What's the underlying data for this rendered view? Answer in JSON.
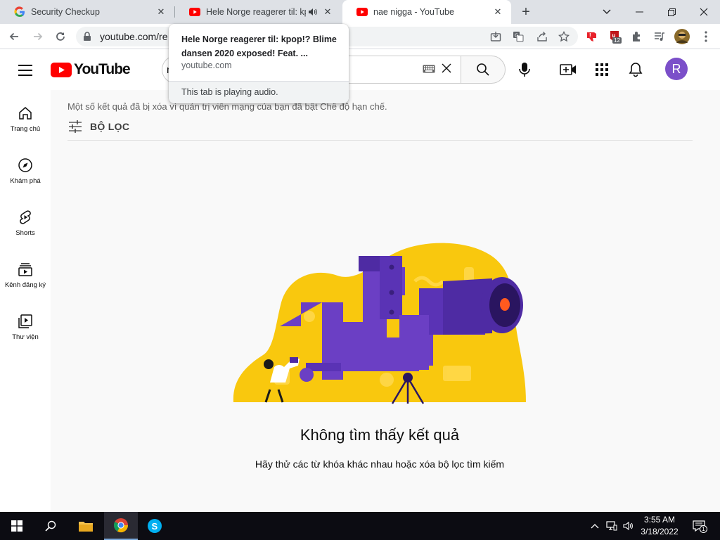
{
  "browser": {
    "tabs": [
      {
        "title": "Security Checkup",
        "favicon": "google-icon"
      },
      {
        "title": "Hele Norge reagerer til: kpop!? Blime dansen 2020 exposed!",
        "favicon": "youtube-icon",
        "audio": true
      },
      {
        "title": "nae nigga - YouTube",
        "favicon": "youtube-icon",
        "active": true
      }
    ],
    "url": "youtube.com/re",
    "hover_card": {
      "title": "Hele Norge reagerer til: kpop!? Blime dansen 2020 exposed! Feat. ...",
      "domain": "youtube.com",
      "footer": "This tab is playing audio."
    },
    "extension_badge": "12"
  },
  "youtube": {
    "logo_text": "YouTube",
    "search_value": "n",
    "avatar_letter": "R",
    "sidebar": [
      {
        "label": "Trang chủ",
        "icon": "home-icon"
      },
      {
        "label": "Khám phá",
        "icon": "explore-icon"
      },
      {
        "label": "Shorts",
        "icon": "shorts-icon"
      },
      {
        "label": "Kênh đăng ký",
        "icon": "subscriptions-icon"
      },
      {
        "label": "Thư viện",
        "icon": "library-icon"
      }
    ],
    "notice": "Một số kết quả đã bị xóa vì quản trị viên mạng của bạn đã bật Chế độ hạn chế.",
    "filter_label": "BỘ LỌC",
    "no_results_title": "Không tìm thấy kết quả",
    "no_results_sub": "Hãy thử các từ khóa khác nhau hoặc xóa bộ lọc tìm kiếm"
  },
  "taskbar": {
    "time": "3:55 AM",
    "date": "3/18/2022",
    "notification_count": "1"
  },
  "colors": {
    "youtube_red": "#ff0000",
    "avatar": "#7b4fc9",
    "illustration_yellow": "#f9c80e",
    "illustration_purple": "#6b3fc4"
  }
}
